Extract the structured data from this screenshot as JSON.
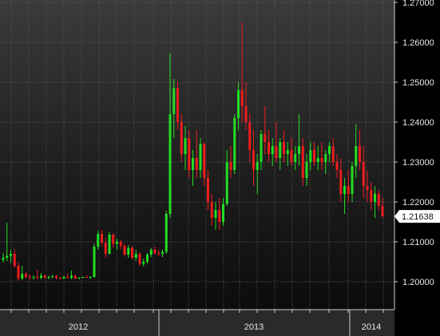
{
  "chart_data": {
    "type": "candlestick",
    "title": "",
    "xlabel": "",
    "ylabel": "",
    "ylim": [
      1.194,
      1.27
    ],
    "grid": true,
    "y_ticks": [
      "1.20000",
      "1.21000",
      "1.22000",
      "1.23000",
      "1.24000",
      "1.25000",
      "1.26000",
      "1.27000"
    ],
    "x_sections": [
      "2012",
      "2013",
      "2014"
    ],
    "last_price": "1.21638",
    "colors": {
      "up": "#22dd22",
      "down": "#ee1c1c",
      "last_label_bg": "#ffffff"
    },
    "candles": [
      [
        1.2055,
        1.2072,
        1.2048,
        1.206
      ],
      [
        1.206,
        1.2148,
        1.2052,
        1.2065
      ],
      [
        1.2065,
        1.208,
        1.2048,
        1.207
      ],
      [
        1.207,
        1.2082,
        1.2035,
        1.204
      ],
      [
        1.204,
        1.2048,
        1.2002,
        1.2008
      ],
      [
        1.2008,
        1.204,
        1.2004,
        1.202
      ],
      [
        1.202,
        1.2024,
        1.2008,
        1.2012
      ],
      [
        1.2012,
        1.2018,
        1.2004,
        1.201
      ],
      [
        1.201,
        1.2016,
        1.2005,
        1.2012
      ],
      [
        1.2012,
        1.203,
        1.2006,
        1.201
      ],
      [
        1.201,
        1.2022,
        1.2006,
        1.2015
      ],
      [
        1.2015,
        1.2018,
        1.2006,
        1.201
      ],
      [
        1.201,
        1.2016,
        1.2006,
        1.2012
      ],
      [
        1.2012,
        1.2018,
        1.2008,
        1.2014
      ],
      [
        1.2014,
        1.2018,
        1.2006,
        1.201
      ],
      [
        1.201,
        1.2012,
        1.2006,
        1.2008
      ],
      [
        1.2008,
        1.2014,
        1.2006,
        1.2012
      ],
      [
        1.2012,
        1.202,
        1.2008,
        1.201
      ],
      [
        1.201,
        1.2028,
        1.2006,
        1.2015
      ],
      [
        1.2015,
        1.2018,
        1.2006,
        1.2008
      ],
      [
        1.2008,
        1.2012,
        1.2006,
        1.201
      ],
      [
        1.201,
        1.2012,
        1.2008,
        1.2012
      ],
      [
        1.2012,
        1.2016,
        1.201,
        1.201
      ],
      [
        1.201,
        1.2014,
        1.2008,
        1.2012
      ],
      [
        1.2012,
        1.2095,
        1.201,
        1.2088
      ],
      [
        1.2088,
        1.2128,
        1.208,
        1.212
      ],
      [
        1.212,
        1.213,
        1.209,
        1.2098
      ],
      [
        1.2098,
        1.211,
        1.206,
        1.207
      ],
      [
        1.207,
        1.2125,
        1.2068,
        1.2118
      ],
      [
        1.2118,
        1.2122,
        1.2085,
        1.2095
      ],
      [
        1.2095,
        1.2108,
        1.208,
        1.21
      ],
      [
        1.21,
        1.2105,
        1.2082,
        1.209
      ],
      [
        1.209,
        1.2095,
        1.2065,
        1.2068
      ],
      [
        1.2068,
        1.2092,
        1.206,
        1.2085
      ],
      [
        1.2085,
        1.209,
        1.2055,
        1.206
      ],
      [
        1.206,
        1.208,
        1.2052,
        1.207
      ],
      [
        1.207,
        1.2074,
        1.204,
        1.2045
      ],
      [
        1.2045,
        1.2058,
        1.2038,
        1.205
      ],
      [
        1.205,
        1.2072,
        1.2045,
        1.2068
      ],
      [
        1.2068,
        1.2085,
        1.2062,
        1.208
      ],
      [
        1.208,
        1.2088,
        1.2068,
        1.2072
      ],
      [
        1.2072,
        1.208,
        1.2065,
        1.207
      ],
      [
        1.207,
        1.208,
        1.2062,
        1.2075
      ],
      [
        1.2075,
        1.2178,
        1.207,
        1.217
      ],
      [
        1.217,
        1.2572,
        1.216,
        1.242
      ],
      [
        1.242,
        1.2508,
        1.236,
        1.2485
      ],
      [
        1.2485,
        1.25,
        1.238,
        1.24
      ],
      [
        1.24,
        1.242,
        1.23,
        1.232
      ],
      [
        1.232,
        1.239,
        1.228,
        1.236
      ],
      [
        1.236,
        1.238,
        1.226,
        1.228
      ],
      [
        1.228,
        1.233,
        1.224,
        1.231
      ],
      [
        1.231,
        1.238,
        1.226,
        1.228
      ],
      [
        1.228,
        1.236,
        1.226,
        1.2345
      ],
      [
        1.2345,
        1.235,
        1.224,
        1.226
      ],
      [
        1.226,
        1.228,
        1.218,
        1.22
      ],
      [
        1.22,
        1.222,
        1.214,
        1.216
      ],
      [
        1.216,
        1.22,
        1.213,
        1.218
      ],
      [
        1.218,
        1.221,
        1.213,
        1.215
      ],
      [
        1.215,
        1.221,
        1.214,
        1.2195
      ],
      [
        1.2195,
        1.233,
        1.219,
        1.23
      ],
      [
        1.23,
        1.234,
        1.226,
        1.228
      ],
      [
        1.228,
        1.242,
        1.227,
        1.241
      ],
      [
        1.241,
        1.25,
        1.238,
        1.248
      ],
      [
        1.248,
        1.265,
        1.24,
        1.244
      ],
      [
        1.244,
        1.25,
        1.238,
        1.24
      ],
      [
        1.24,
        1.242,
        1.23,
        1.233
      ],
      [
        1.233,
        1.238,
        1.224,
        1.228
      ],
      [
        1.228,
        1.232,
        1.222,
        1.23
      ],
      [
        1.23,
        1.238,
        1.228,
        1.237
      ],
      [
        1.237,
        1.244,
        1.232,
        1.235
      ],
      [
        1.235,
        1.238,
        1.23,
        1.232
      ],
      [
        1.232,
        1.236,
        1.229,
        1.234
      ],
      [
        1.234,
        1.24,
        1.23,
        1.231
      ],
      [
        1.231,
        1.236,
        1.228,
        1.235
      ],
      [
        1.235,
        1.238,
        1.23,
        1.232
      ],
      [
        1.232,
        1.235,
        1.229,
        1.233
      ],
      [
        1.233,
        1.236,
        1.229,
        1.23
      ],
      [
        1.23,
        1.234,
        1.228,
        1.232
      ],
      [
        1.232,
        1.242,
        1.229,
        1.234
      ],
      [
        1.234,
        1.236,
        1.224,
        1.226
      ],
      [
        1.226,
        1.232,
        1.224,
        1.23
      ],
      [
        1.23,
        1.235,
        1.228,
        1.233
      ],
      [
        1.233,
        1.235,
        1.229,
        1.23
      ],
      [
        1.23,
        1.234,
        1.228,
        1.231
      ],
      [
        1.231,
        1.235,
        1.228,
        1.23
      ],
      [
        1.23,
        1.233,
        1.227,
        1.232
      ],
      [
        1.232,
        1.235,
        1.23,
        1.234
      ],
      [
        1.234,
        1.236,
        1.229,
        1.23
      ],
      [
        1.23,
        1.232,
        1.226,
        1.228
      ],
      [
        1.228,
        1.231,
        1.22,
        1.222
      ],
      [
        1.222,
        1.226,
        1.217,
        1.224
      ],
      [
        1.224,
        1.228,
        1.22,
        1.222
      ],
      [
        1.222,
        1.23,
        1.22,
        1.229
      ],
      [
        1.229,
        1.2395,
        1.226,
        1.234
      ],
      [
        1.234,
        1.238,
        1.228,
        1.23
      ],
      [
        1.23,
        1.234,
        1.221,
        1.224
      ],
      [
        1.224,
        1.228,
        1.22,
        1.223
      ],
      [
        1.223,
        1.225,
        1.218,
        1.22
      ],
      [
        1.22,
        1.224,
        1.216,
        1.222
      ],
      [
        1.222,
        1.223,
        1.218,
        1.219
      ],
      [
        1.219,
        1.221,
        1.216,
        1.2164
      ]
    ]
  }
}
